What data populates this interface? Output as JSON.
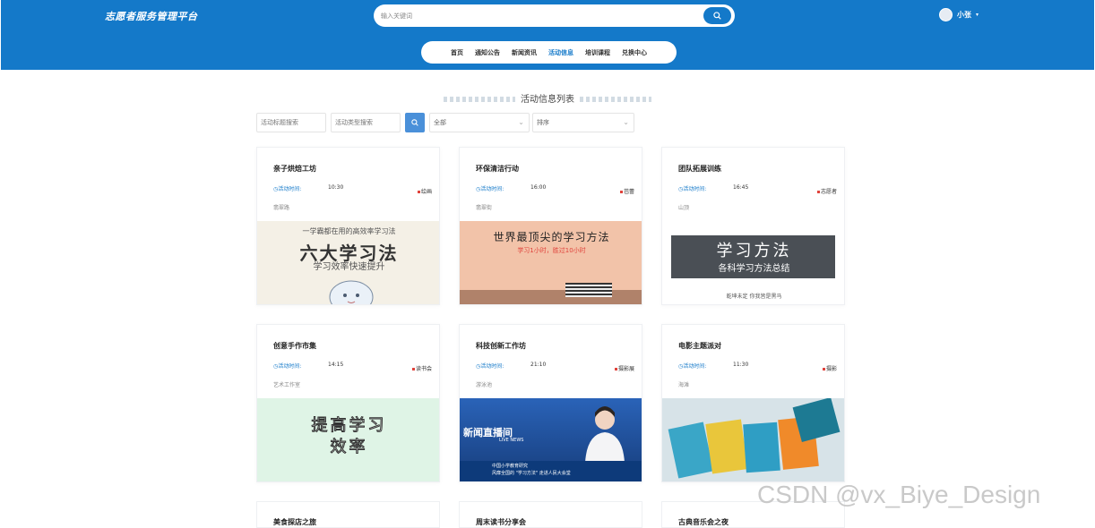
{
  "header": {
    "site_title": "志愿者服务管理平台",
    "search_placeholder": "输入关键词",
    "user_name": "小张",
    "user_caret": "▾"
  },
  "nav": {
    "items": [
      "首页",
      "通知公告",
      "新闻资讯",
      "活动信息",
      "培训课程",
      "兑换中心"
    ],
    "active": "活动信息"
  },
  "section_title": "活动信息列表",
  "filters": {
    "title_placeholder": "活动标题搜索",
    "type_placeholder": "活动类型搜索",
    "select_all": "全部",
    "select_sort": "排序"
  },
  "cards": [
    {
      "title": "亲子烘焙工坊",
      "time_label": "◷活动时间:",
      "time": "10:30",
      "tag": "绘画",
      "location": "翡翠路",
      "image": {
        "line1": "一学霸都在用的高效率学习法",
        "line2": "六大学习法",
        "line3": "学习效率快速提升",
        "bg": "#f4f0e6"
      }
    },
    {
      "title": "环保清洁行动",
      "time_label": "◷活动时间:",
      "time": "16:00",
      "tag": "芭蕾",
      "location": "翡翠街",
      "image": {
        "line1": "世界最顶尖的学习方法",
        "line2": "学习1小时，胜过10小时",
        "bg": "#f2c3a9"
      }
    },
    {
      "title": "团队拓展训练",
      "time_label": "◷活动时间:",
      "time": "16:45",
      "tag": "志愿者",
      "location": "山顶",
      "image": {
        "line1": "学习方法",
        "line2": "各科学习方法总结",
        "line3": "乾坤未定 你我皆是黑马",
        "bg": "#ffffff"
      }
    },
    {
      "title": "创意手作市集",
      "time_label": "◷活动时间:",
      "time": "14:15",
      "tag": "读书会",
      "location": "艺术工作室",
      "image": {
        "line1": "提高学习",
        "line2": "效率",
        "bg": "#dff4e6"
      }
    },
    {
      "title": "科技创新工作坊",
      "time_label": "◷活动时间:",
      "time": "21:10",
      "tag": "摄影展",
      "location": "游泳池",
      "image": {
        "line1": "新闻直播间",
        "line2": "LIVE NEWS",
        "line3": "中国小学教育研究",
        "line4": "风靡全国的 \"学习方法\" 走进人民大会堂",
        "bg": "#1f4f9a"
      }
    },
    {
      "title": "电影主题派对",
      "time_label": "◷活动时间:",
      "time": "11:30",
      "tag": "摄影",
      "location": "海滩",
      "image": {
        "bg": "#d7e3e8"
      }
    }
  ],
  "cut_cards": [
    "美食探店之旅",
    "周末读书分享会",
    "古典音乐会之夜"
  ],
  "watermark": "CSDN @vx_Biye_Design",
  "colors": {
    "primary": "#1479c9",
    "tag_dot": "#e0433c"
  }
}
